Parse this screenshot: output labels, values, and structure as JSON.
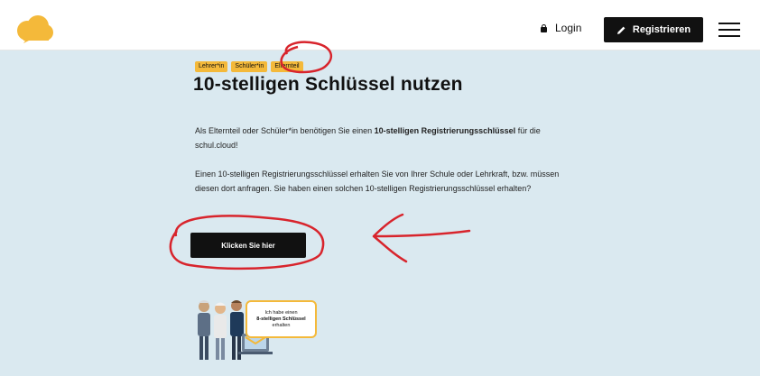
{
  "header": {
    "login_label": "Login",
    "register_label": "Registrieren",
    "logo_icon": "cloud-logo-icon",
    "lock_icon": "lock-icon",
    "pencil_icon": "pencil-icon",
    "menu_icon": "hamburger-menu-icon"
  },
  "main": {
    "tags": [
      "Lehrer*in",
      "Schüler*in",
      "Elternteil"
    ],
    "title": "10-stelligen Schlüssel nutzen",
    "paragraph1_pre": "Als Elternteil oder Schüler*in benötigen Sie einen ",
    "paragraph1_bold": "10-stelligen Registrierungsschlüssel",
    "paragraph1_post": " für die schul.cloud!",
    "paragraph2": "Einen 10-stelligen Registrierungsschlüssel erhalten Sie von Ihrer Schule oder Lehrkraft, bzw. müssen diesen dort anfragen. Sie haben einen solchen 10-stelligen Registrierungsschlüssel erhalten?",
    "cta_label": "Klicken Sie hier"
  },
  "illustration": {
    "bubble_line1": "Ich habe einen",
    "bubble_line2": "8-stelligen Schlüssel",
    "bubble_line3": "erhalten"
  },
  "colors": {
    "accent": "#f4b93a",
    "background": "#dae9f0",
    "button": "#111111",
    "annotation": "#d8242c"
  }
}
